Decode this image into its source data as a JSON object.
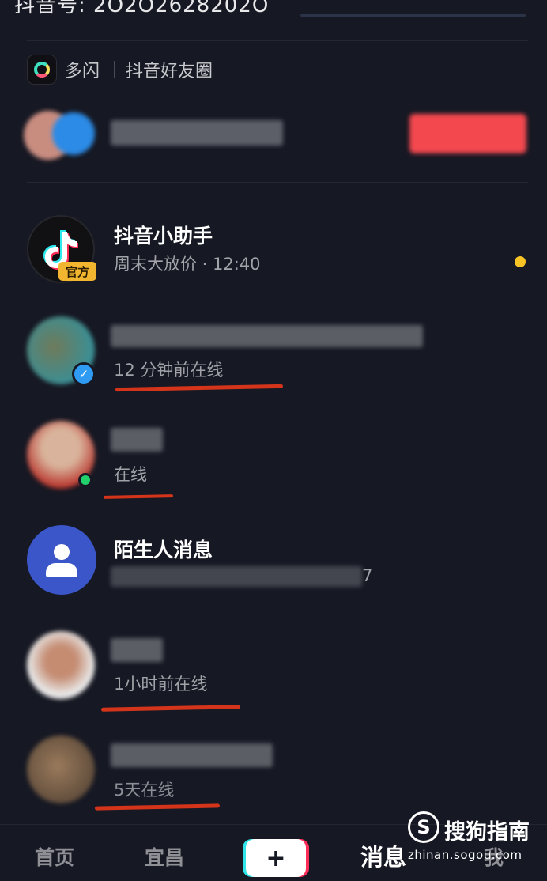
{
  "header": {
    "douyin_id": "抖音号: 2O2O2628202O"
  },
  "shortcuts": {
    "duoshan_label": "多闪",
    "friend_circle_label": "抖音好友圈"
  },
  "messages": [
    {
      "name": "抖音小助手",
      "subtitle": "周末大放价 · 12:40",
      "badge": "官方",
      "unread": true
    },
    {
      "status": "12 分钟前在线",
      "verified": true
    },
    {
      "status": "在线",
      "online": true
    },
    {
      "name": "陌生人消息",
      "trailing_digit": "7"
    },
    {
      "status": "1小时前在线"
    },
    {
      "status": "5天在线"
    }
  ],
  "bottom_nav": {
    "home": "首页",
    "city": "宜昌",
    "plus": "+",
    "messages": "消息",
    "me": "我"
  },
  "watermark": {
    "logo": "S",
    "text": "搜狗指南",
    "url": "zhinan.sogou.com"
  },
  "colors": {
    "background": "#161823",
    "red_button": "#f4484f",
    "unread_dot": "#f7c325",
    "online_dot": "#22d16b",
    "verified_badge": "#2f9bf2",
    "stranger_avatar": "#3b56c9",
    "annotation_red": "#d4341a"
  }
}
